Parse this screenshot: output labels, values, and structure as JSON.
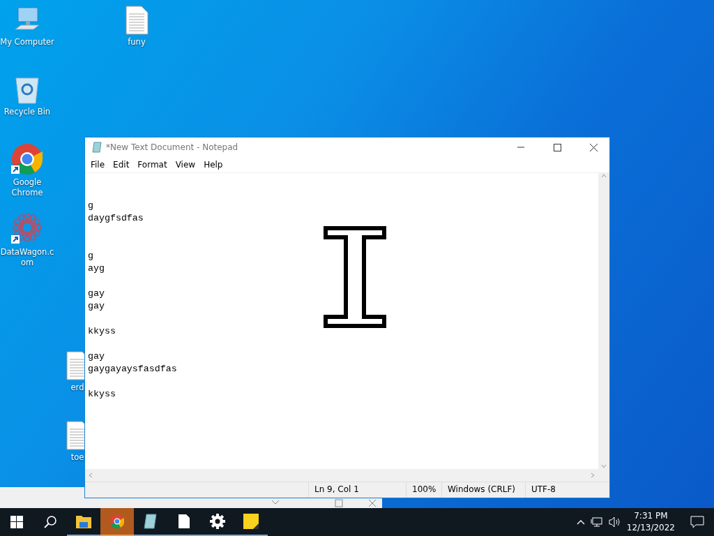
{
  "desktop": {
    "icons": [
      {
        "label": "My Computer",
        "kind": "computer"
      },
      {
        "label": "funy",
        "kind": "file"
      },
      {
        "label": "Recycle Bin",
        "kind": "recycle"
      },
      {
        "label": "Google Chrome",
        "kind": "chrome"
      },
      {
        "label": "DataWagon.com",
        "kind": "web"
      },
      {
        "label": "erd",
        "kind": "file"
      },
      {
        "label": "toe",
        "kind": "file"
      }
    ]
  },
  "notepad": {
    "title": "*New Text Document - Notepad",
    "menu": [
      "File",
      "Edit",
      "Format",
      "View",
      "Help"
    ],
    "text": "\n\ng\ndaygfsdfas\n\n\ng\nayg\n\ngay\ngay\n\nkkyss\n\ngay\ngaygayaysfasdfas\n\nkkyss",
    "status": [
      "Ln 9, Col 1",
      "100%",
      "Windows (CRLF)",
      "UTF-8"
    ]
  },
  "taskbar": {
    "apps": [
      {
        "kind": "folder",
        "selected": false
      },
      {
        "kind": "chrome",
        "selected": true
      },
      {
        "kind": "notepad",
        "selected": false
      },
      {
        "kind": "file",
        "selected": false
      },
      {
        "kind": "settings",
        "selected": false
      },
      {
        "kind": "sticky",
        "selected": false
      }
    ],
    "time": "7:31 PM",
    "date": "12/13/2022"
  }
}
